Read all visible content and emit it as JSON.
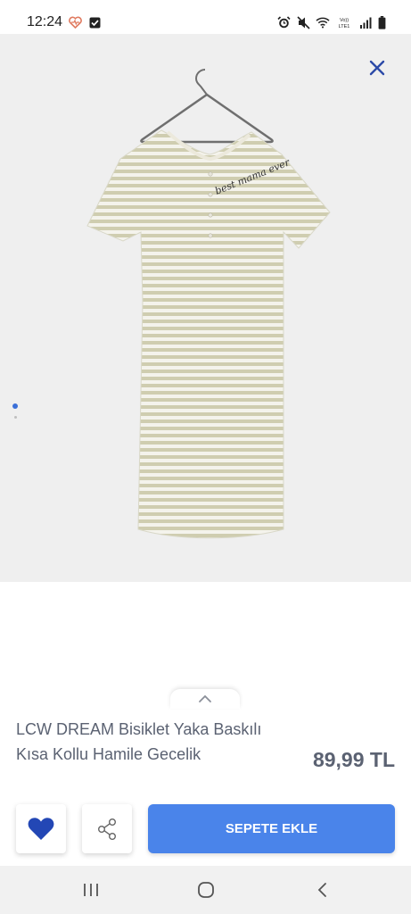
{
  "status_bar": {
    "time": "12:24",
    "left_icons": [
      "heart-rate-icon",
      "checkbox-notification-icon"
    ],
    "right_icons": [
      "alarm-icon",
      "mute-icon",
      "wifi-icon",
      "volte-icon",
      "signal-icon",
      "battery-icon"
    ],
    "volte_label": "VoLTE1"
  },
  "product_image": {
    "alt": "LCW DREAM Bisiklet Yaka Baskılı Kısa Kollu Hamile Gecelik",
    "print_text": "best mama ever",
    "stripe_color": "#c9c7a8",
    "base_color": "#f4f3ec"
  },
  "carousel": {
    "count": 2,
    "active_index": 0
  },
  "product": {
    "title": "LCW DREAM Bisiklet Yaka Baskılı Kısa Kollu Hamile Gecelik",
    "price": "89,99 TL"
  },
  "actions": {
    "add_to_cart_label": "SEPETE EKLE"
  },
  "colors": {
    "accent": "#4a84ea",
    "favorite": "#2347b5",
    "text": "#5b6272"
  },
  "nav": {
    "items": [
      "recent-apps-icon",
      "home-icon",
      "back-icon"
    ]
  }
}
